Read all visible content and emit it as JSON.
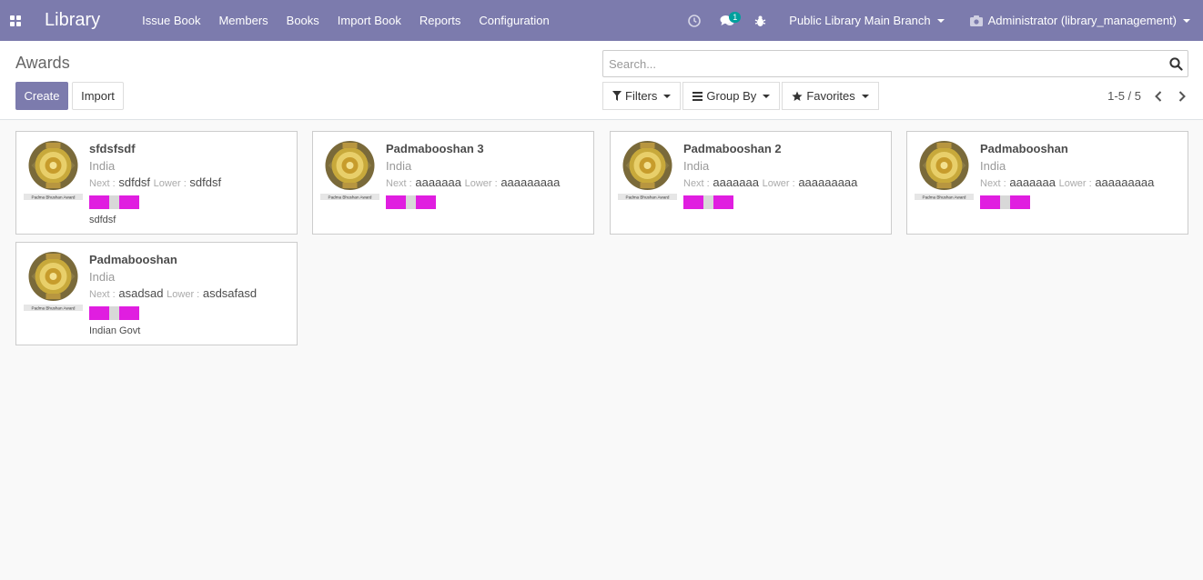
{
  "navbar": {
    "brand": "Library",
    "menu": [
      "Issue Book",
      "Members",
      "Books",
      "Import Book",
      "Reports",
      "Configuration"
    ],
    "messages_count": "1",
    "company": "Public Library Main Branch",
    "user": "Administrator (library_management)",
    "bg_color": "#7c7bad"
  },
  "control_panel": {
    "title": "Awards",
    "create_label": "Create",
    "import_label": "Import",
    "search_placeholder": "Search...",
    "filters_label": "Filters",
    "groupby_label": "Group By",
    "favorites_label": "Favorites",
    "pager": "1-5 / 5"
  },
  "card_labels": {
    "next": "Next :",
    "lower": "Lower :"
  },
  "award_image_caption": "Padma Bhushan Award",
  "cards": [
    {
      "title": "sfdsfsdf",
      "country": "India",
      "next": "sdfdsf",
      "lower": "sdfdsf",
      "extra": "sdfdsf"
    },
    {
      "title": "Padmabooshan 3",
      "country": "India",
      "next": "aaaaaaa",
      "lower": "aaaaaaaaa",
      "extra": ""
    },
    {
      "title": "Padmabooshan 2",
      "country": "India",
      "next": "aaaaaaa",
      "lower": "aaaaaaaaa",
      "extra": ""
    },
    {
      "title": "Padmabooshan",
      "country": "India",
      "next": "aaaaaaa",
      "lower": "aaaaaaaaa",
      "extra": ""
    },
    {
      "title": "Padmabooshan",
      "country": "India",
      "next": "asadsad",
      "lower": "asdsafasd",
      "extra": "Indian Govt"
    }
  ],
  "colors": {
    "tag_magenta": "#e01ee0",
    "tag_gray": "#d8d8d8",
    "primary": "#7c7bad"
  }
}
